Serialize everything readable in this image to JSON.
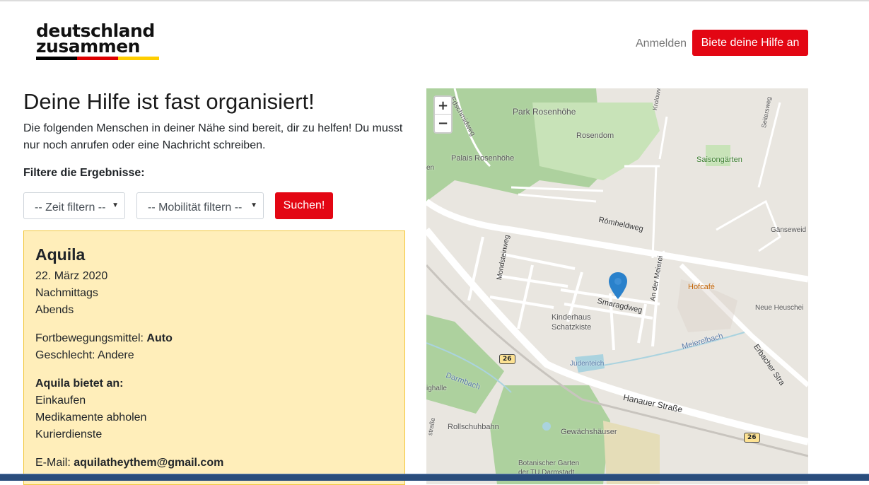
{
  "brand": {
    "line1": "deutschland",
    "line2": "zusammen",
    "flag_colors": [
      "#000000",
      "#dd0000",
      "#ffce00"
    ]
  },
  "nav": {
    "login": "Anmelden",
    "offer_help": "Biete deine Hilfe an"
  },
  "page": {
    "title": "Deine Hilfe ist fast organisiert!",
    "lead": "Die folgenden Menschen in deiner Nähe sind bereit, dir zu helfen! Du musst nur noch anrufen oder eine Nachricht schreiben."
  },
  "filters": {
    "label": "Filtere die Ergebnisse:",
    "time": "-- Zeit filtern --",
    "mobility": "-- Mobilität filtern --",
    "search": "Suchen!"
  },
  "result": {
    "name": "Aquila",
    "date": "22. März 2020",
    "times": [
      "Nachmittags",
      "Abends"
    ],
    "mobility_label": "Fortbewegungsmittel:",
    "mobility_value": "Auto",
    "gender": "Geschlecht: Andere",
    "offers_label": "Aquila bietet an:",
    "offers": [
      "Einkaufen",
      "Medikamente abholen",
      "Kurierdienste"
    ],
    "email_label": "E-Mail:",
    "email_value": "aquilatheythem@gmail.com"
  },
  "map": {
    "zoom_in": "+",
    "zoom_out": "−",
    "labels": [
      "Park Rosenhöhe",
      "Rosendom",
      "Palais Rosenhöhe",
      "Saisongärten",
      "Römheldweg",
      "Gänseweid",
      "Mondsteinweg",
      "Smaragdweg",
      "Hofcafé",
      "Kinderhaus",
      "Schatzkiste",
      "An der Meierei",
      "Neue Heuschei",
      "Erbacher Stra",
      "Meierelbach",
      "Judenteich",
      "Darmbach",
      "Hanauer Straße",
      "ighalle",
      "Rollschuhbahn",
      "Gewächshäuser",
      "Botanischer Garten",
      "der TU Darmstadt",
      "Edschmidweg",
      "Krolowweg",
      "Seitersweg",
      "en",
      "straße"
    ],
    "shields": [
      "26",
      "26"
    ],
    "colors": {
      "park": "#add19e",
      "water": "#aad3df",
      "road": "#ffffff",
      "base": "#e9e6e0",
      "marker": "#2a81cb"
    }
  }
}
